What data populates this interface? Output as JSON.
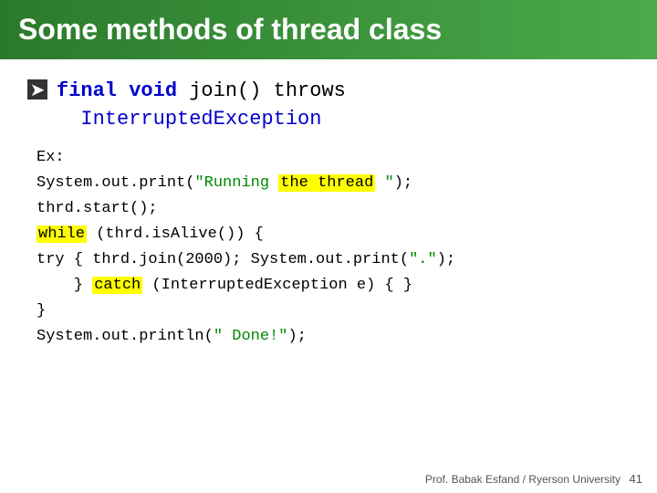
{
  "slide": {
    "title": "Some methods of thread class",
    "bullet": {
      "label": "❚",
      "method_line1_parts": [
        {
          "text": "final ",
          "type": "keyword"
        },
        {
          "text": "void ",
          "type": "keyword"
        },
        {
          "text": "join() ",
          "type": "method"
        },
        {
          "text": "throws",
          "type": "normal"
        }
      ],
      "method_line2": "InterruptedException"
    },
    "code": {
      "lines": [
        "Ex:",
        "System.out.print(\"Running the thread \");",
        "thrd.start();",
        "while (thrd.isAlive()) {",
        "try { thrd.join(2000); System.out.print(\".\");",
        "    } catch (InterruptedException e) { }",
        "}",
        "System.out.println(\" Done!\");"
      ]
    },
    "page_number": "41",
    "footer": "Prof. Babak Esfand / Ryerson University"
  }
}
